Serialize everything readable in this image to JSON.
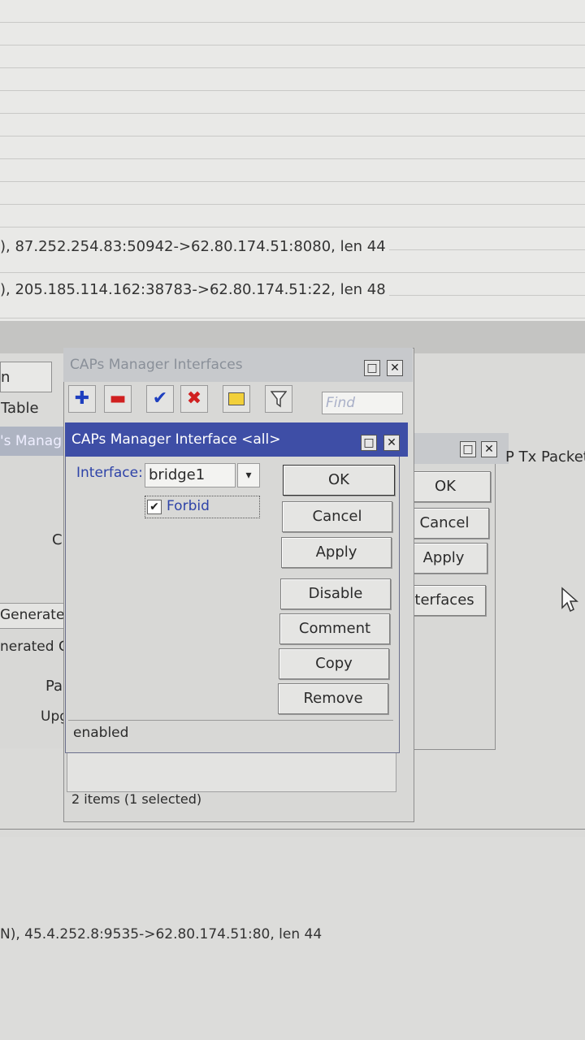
{
  "log_lines": [
    "), 87.252.254.83:50942->62.80.174.51:8080, len 44",
    "), 205.185.114.162:38783->62.80.174.51:22, len 48",
    "N), 45.4.252.8:9535->62.80.174.51:80, len 44"
  ],
  "left_partial": {
    "table_tab": "n Table",
    "manager_tab": "'s Manag",
    "c_label": "C",
    "generate": "Generate",
    "nerated": "nerated C",
    "pa": "Pa",
    "upg": "Upg"
  },
  "back_window": {
    "column_header": "P Tx Packet",
    "ok": "OK",
    "cancel": "Cancel",
    "apply": "Apply",
    "interfaces": "nterfaces"
  },
  "interfaces_window": {
    "title": "CAPs Manager Interfaces",
    "find_placeholder": "Find",
    "status": "2 items (1 selected)"
  },
  "interface_dialog": {
    "title": "CAPs Manager Interface <all>",
    "interface_label": "Interface:",
    "interface_value": "bridge1",
    "forbid_label": "Forbid",
    "forbid_checked": true,
    "buttons": {
      "ok": "OK",
      "cancel": "Cancel",
      "apply": "Apply",
      "disable": "Disable",
      "comment": "Comment",
      "copy": "Copy",
      "remove": "Remove"
    },
    "status": "enabled"
  },
  "colors": {
    "active_title": "#3e4ea6",
    "inactive_title": "#c7c9cc",
    "add_icon": "#1e3fbf",
    "remove_icon": "#d02020",
    "enable_icon": "#1e3fbf",
    "disable_icon": "#d02020"
  }
}
